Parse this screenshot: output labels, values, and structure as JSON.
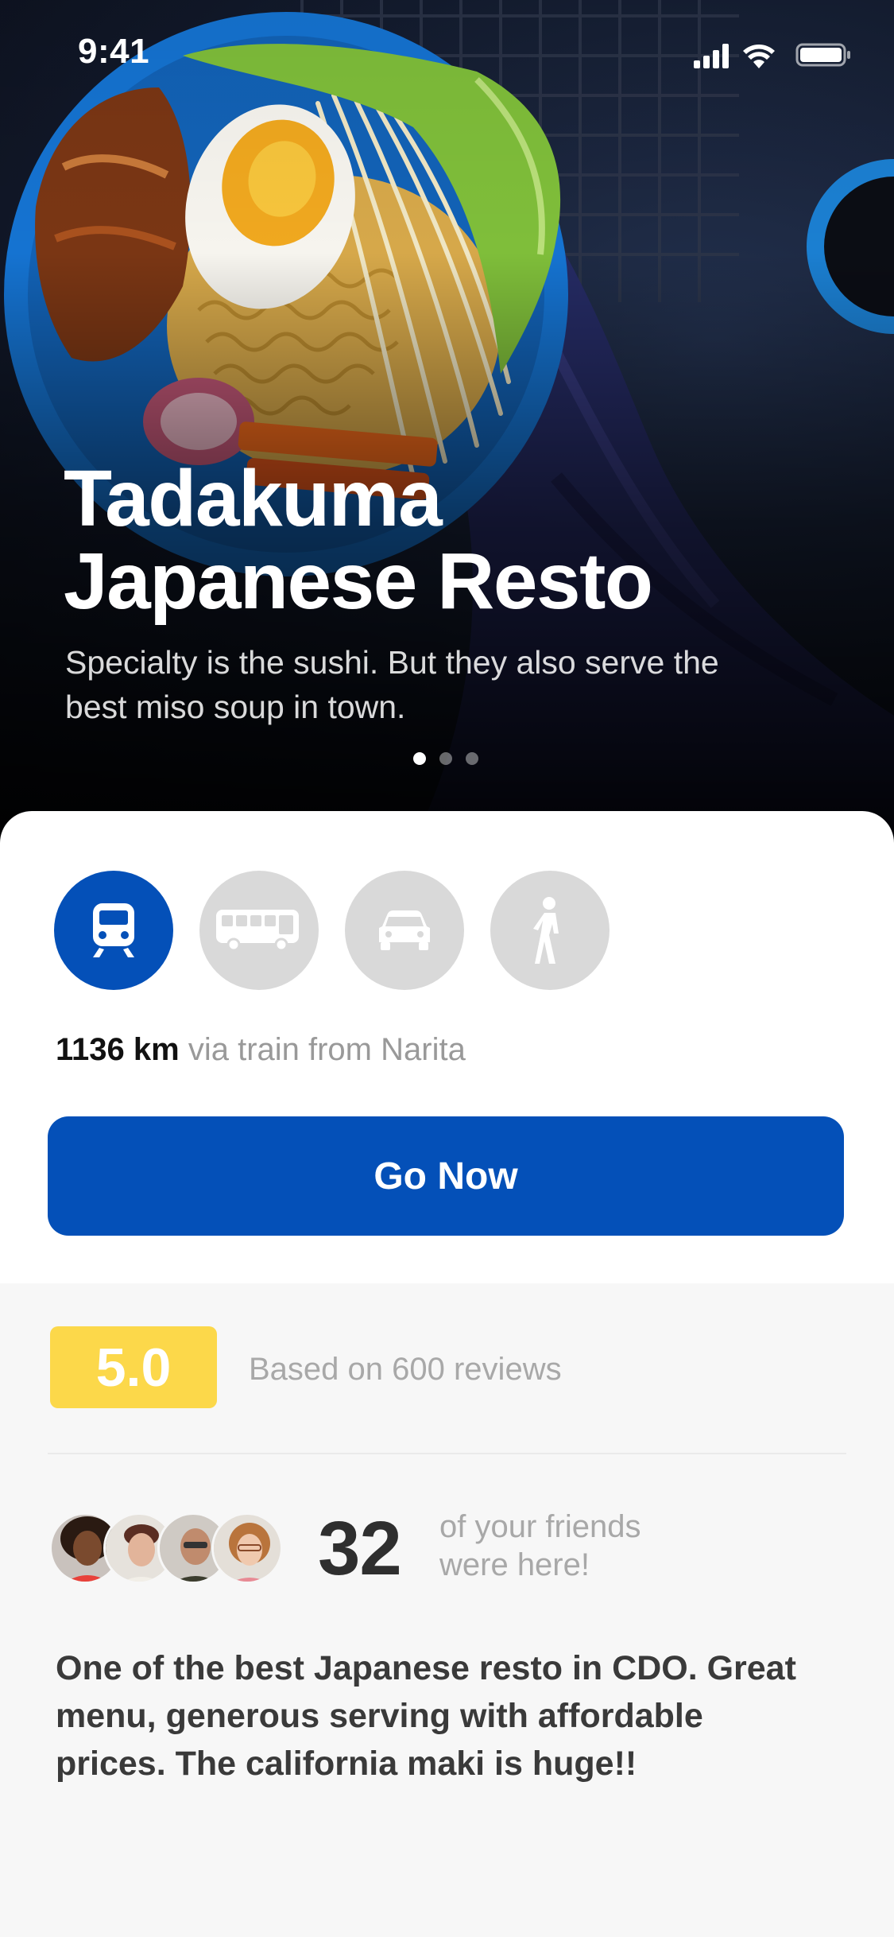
{
  "status_bar": {
    "time": "9:41"
  },
  "hero": {
    "title_line1": "Tadakuma",
    "title_line2": "Japanese Resto",
    "subtitle": "Specialty is the sushi. But they also serve the best miso soup in town.",
    "pages": 3,
    "active_page": 1
  },
  "transport": {
    "options": [
      {
        "name": "train",
        "icon": "train-icon",
        "selected": true
      },
      {
        "name": "bus",
        "icon": "bus-icon",
        "selected": false
      },
      {
        "name": "car",
        "icon": "car-icon",
        "selected": false
      },
      {
        "name": "walk",
        "icon": "walk-icon",
        "selected": false
      }
    ],
    "distance_value": "1136 km",
    "distance_detail": "via train from Narita"
  },
  "go_button": {
    "label": "Go Now"
  },
  "rating": {
    "score": "5.0",
    "text": "Based on 600 reviews"
  },
  "friends": {
    "count": "32",
    "text": "of your friends were here!"
  },
  "review": {
    "text": "One of the best Japanese resto in CDO. Great menu, generous serving with affordable prices. The california maki is huge!!"
  },
  "colors": {
    "primary": "#0450b8",
    "rating": "#fcd84a",
    "inactive_icon_bg": "#d9d9d9",
    "muted_text": "#a8a8a8"
  }
}
